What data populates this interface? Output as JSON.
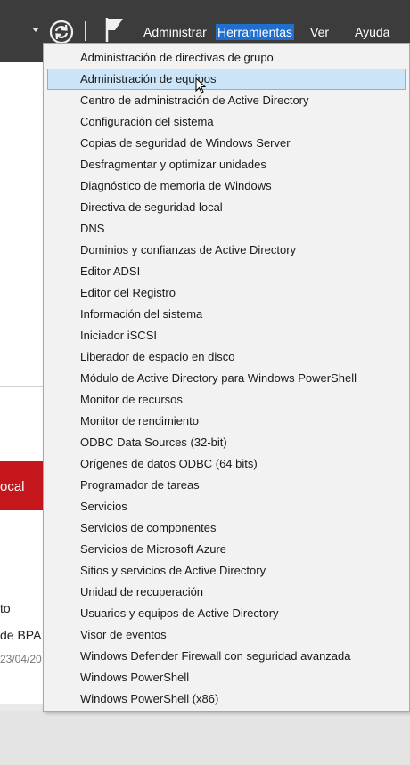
{
  "toolbar": {
    "menus": [
      {
        "label": "Administrar"
      },
      {
        "label": "Herramientas"
      },
      {
        "label": "Ver"
      },
      {
        "label": "Ayuda"
      }
    ]
  },
  "background": {
    "red_tile": "ocal",
    "line1": "to",
    "line2": "de BPA",
    "date": "23/04/20"
  },
  "tools_menu": {
    "items": [
      "Administración de directivas de grupo",
      "Administración de equipos",
      "Centro de administración de Active Directory",
      "Configuración del sistema",
      "Copias de seguridad de Windows Server",
      "Desfragmentar y optimizar unidades",
      "Diagnóstico de memoria de Windows",
      "Directiva de seguridad local",
      "DNS",
      "Dominios y confianzas de Active Directory",
      "Editor ADSI",
      "Editor del Registro",
      "Información del sistema",
      "Iniciador iSCSI",
      "Liberador de espacio en disco",
      "Módulo de Active Directory para Windows PowerShell",
      "Monitor de recursos",
      "Monitor de rendimiento",
      "ODBC Data Sources (32-bit)",
      "Orígenes de datos ODBC (64 bits)",
      "Programador de tareas",
      "Servicios",
      "Servicios de componentes",
      "Servicios de Microsoft Azure",
      "Sitios y servicios de Active Directory",
      "Unidad de recuperación",
      "Usuarios y equipos de Active Directory",
      "Visor de eventos",
      "Windows Defender Firewall con seguridad avanzada",
      "Windows PowerShell",
      "Windows PowerShell (x86)"
    ],
    "highlighted_index": 1
  }
}
